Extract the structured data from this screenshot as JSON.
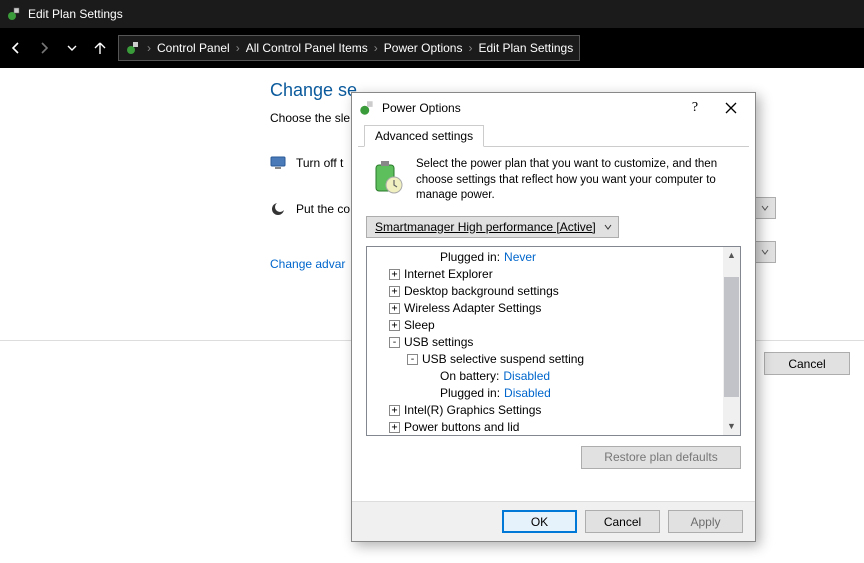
{
  "window": {
    "title": "Edit Plan Settings"
  },
  "breadcrumb": {
    "seg1": "Control Panel",
    "seg2": "All Control Panel Items",
    "seg3": "Power Options",
    "seg4": "Edit Plan Settings"
  },
  "page": {
    "heading": "Change se",
    "subtext": "Choose the sle",
    "row1": "Turn off t",
    "row2": "Put the co",
    "link": "Change advar",
    "cancel": "Cancel"
  },
  "dialog": {
    "title": "Power Options",
    "tab": "Advanced settings",
    "desc": "Select the power plan that you want to customize, and then choose settings that reflect how you want your computer to manage power.",
    "plan": "Smartmanager High performance [Active]",
    "restore": "Restore plan defaults",
    "ok": "OK",
    "cancel": "Cancel",
    "apply": "Apply"
  },
  "tree": {
    "n0": "Plugged in:",
    "v0": "Never",
    "n1": "Internet Explorer",
    "n2": "Desktop background settings",
    "n3": "Wireless Adapter Settings",
    "n4": "Sleep",
    "n5": "USB settings",
    "n6": "USB selective suspend setting",
    "n7": "On battery:",
    "v7": "Disabled",
    "n8": "Plugged in:",
    "v8": "Disabled",
    "n9": "Intel(R) Graphics Settings",
    "n10": "Power buttons and lid"
  }
}
